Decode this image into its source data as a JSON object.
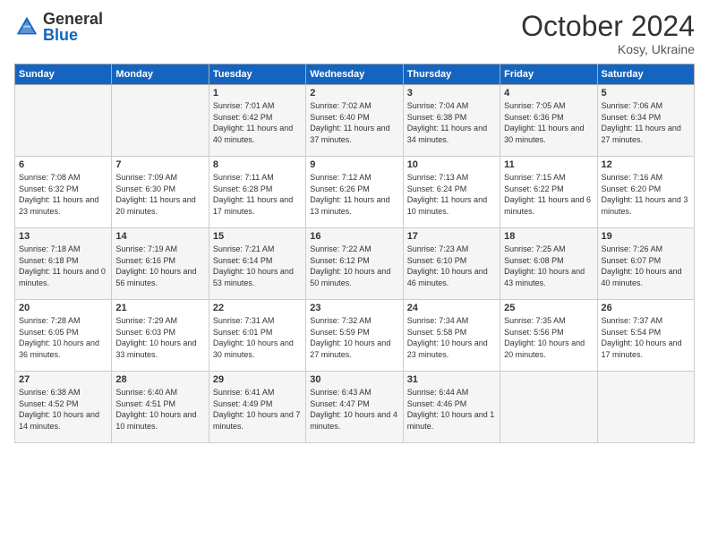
{
  "header": {
    "logo_general": "General",
    "logo_blue": "Blue",
    "month": "October 2024",
    "location": "Kosy, Ukraine"
  },
  "days_of_week": [
    "Sunday",
    "Monday",
    "Tuesday",
    "Wednesday",
    "Thursday",
    "Friday",
    "Saturday"
  ],
  "weeks": [
    [
      {
        "day": "",
        "info": ""
      },
      {
        "day": "",
        "info": ""
      },
      {
        "day": "1",
        "info": "Sunrise: 7:01 AM\nSunset: 6:42 PM\nDaylight: 11 hours\nand 40 minutes."
      },
      {
        "day": "2",
        "info": "Sunrise: 7:02 AM\nSunset: 6:40 PM\nDaylight: 11 hours\nand 37 minutes."
      },
      {
        "day": "3",
        "info": "Sunrise: 7:04 AM\nSunset: 6:38 PM\nDaylight: 11 hours\nand 34 minutes."
      },
      {
        "day": "4",
        "info": "Sunrise: 7:05 AM\nSunset: 6:36 PM\nDaylight: 11 hours\nand 30 minutes."
      },
      {
        "day": "5",
        "info": "Sunrise: 7:06 AM\nSunset: 6:34 PM\nDaylight: 11 hours\nand 27 minutes."
      }
    ],
    [
      {
        "day": "6",
        "info": "Sunrise: 7:08 AM\nSunset: 6:32 PM\nDaylight: 11 hours\nand 23 minutes."
      },
      {
        "day": "7",
        "info": "Sunrise: 7:09 AM\nSunset: 6:30 PM\nDaylight: 11 hours\nand 20 minutes."
      },
      {
        "day": "8",
        "info": "Sunrise: 7:11 AM\nSunset: 6:28 PM\nDaylight: 11 hours\nand 17 minutes."
      },
      {
        "day": "9",
        "info": "Sunrise: 7:12 AM\nSunset: 6:26 PM\nDaylight: 11 hours\nand 13 minutes."
      },
      {
        "day": "10",
        "info": "Sunrise: 7:13 AM\nSunset: 6:24 PM\nDaylight: 11 hours\nand 10 minutes."
      },
      {
        "day": "11",
        "info": "Sunrise: 7:15 AM\nSunset: 6:22 PM\nDaylight: 11 hours\nand 6 minutes."
      },
      {
        "day": "12",
        "info": "Sunrise: 7:16 AM\nSunset: 6:20 PM\nDaylight: 11 hours\nand 3 minutes."
      }
    ],
    [
      {
        "day": "13",
        "info": "Sunrise: 7:18 AM\nSunset: 6:18 PM\nDaylight: 11 hours\nand 0 minutes."
      },
      {
        "day": "14",
        "info": "Sunrise: 7:19 AM\nSunset: 6:16 PM\nDaylight: 10 hours\nand 56 minutes."
      },
      {
        "day": "15",
        "info": "Sunrise: 7:21 AM\nSunset: 6:14 PM\nDaylight: 10 hours\nand 53 minutes."
      },
      {
        "day": "16",
        "info": "Sunrise: 7:22 AM\nSunset: 6:12 PM\nDaylight: 10 hours\nand 50 minutes."
      },
      {
        "day": "17",
        "info": "Sunrise: 7:23 AM\nSunset: 6:10 PM\nDaylight: 10 hours\nand 46 minutes."
      },
      {
        "day": "18",
        "info": "Sunrise: 7:25 AM\nSunset: 6:08 PM\nDaylight: 10 hours\nand 43 minutes."
      },
      {
        "day": "19",
        "info": "Sunrise: 7:26 AM\nSunset: 6:07 PM\nDaylight: 10 hours\nand 40 minutes."
      }
    ],
    [
      {
        "day": "20",
        "info": "Sunrise: 7:28 AM\nSunset: 6:05 PM\nDaylight: 10 hours\nand 36 minutes."
      },
      {
        "day": "21",
        "info": "Sunrise: 7:29 AM\nSunset: 6:03 PM\nDaylight: 10 hours\nand 33 minutes."
      },
      {
        "day": "22",
        "info": "Sunrise: 7:31 AM\nSunset: 6:01 PM\nDaylight: 10 hours\nand 30 minutes."
      },
      {
        "day": "23",
        "info": "Sunrise: 7:32 AM\nSunset: 5:59 PM\nDaylight: 10 hours\nand 27 minutes."
      },
      {
        "day": "24",
        "info": "Sunrise: 7:34 AM\nSunset: 5:58 PM\nDaylight: 10 hours\nand 23 minutes."
      },
      {
        "day": "25",
        "info": "Sunrise: 7:35 AM\nSunset: 5:56 PM\nDaylight: 10 hours\nand 20 minutes."
      },
      {
        "day": "26",
        "info": "Sunrise: 7:37 AM\nSunset: 5:54 PM\nDaylight: 10 hours\nand 17 minutes."
      }
    ],
    [
      {
        "day": "27",
        "info": "Sunrise: 6:38 AM\nSunset: 4:52 PM\nDaylight: 10 hours\nand 14 minutes."
      },
      {
        "day": "28",
        "info": "Sunrise: 6:40 AM\nSunset: 4:51 PM\nDaylight: 10 hours\nand 10 minutes."
      },
      {
        "day": "29",
        "info": "Sunrise: 6:41 AM\nSunset: 4:49 PM\nDaylight: 10 hours\nand 7 minutes."
      },
      {
        "day": "30",
        "info": "Sunrise: 6:43 AM\nSunset: 4:47 PM\nDaylight: 10 hours\nand 4 minutes."
      },
      {
        "day": "31",
        "info": "Sunrise: 6:44 AM\nSunset: 4:46 PM\nDaylight: 10 hours\nand 1 minute."
      },
      {
        "day": "",
        "info": ""
      },
      {
        "day": "",
        "info": ""
      }
    ]
  ]
}
